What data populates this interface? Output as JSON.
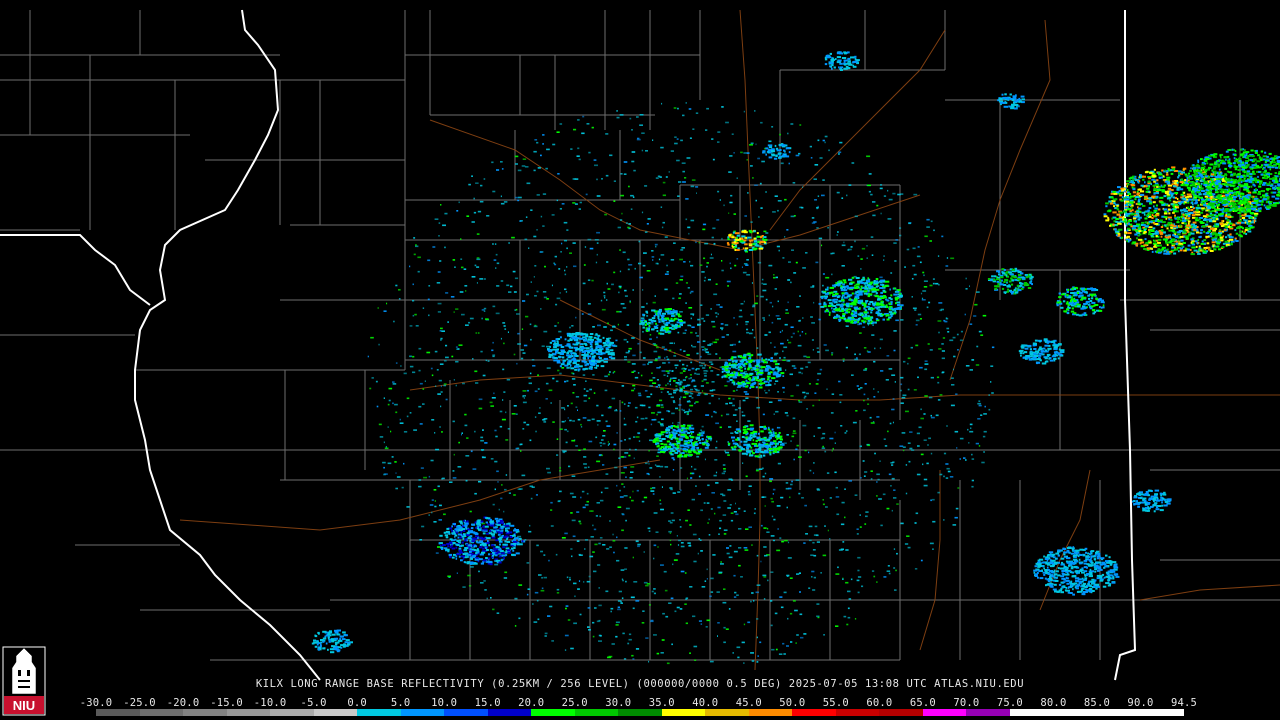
{
  "product_caption": "KILX LONG RANGE BASE REFLECTIVITY (0.25KM / 256 LEVEL) (000000/0000 0.5 DEG) 2025-07-05 13:08 UTC  ATLAS.NIU.EDU",
  "logo": {
    "text": "NIU",
    "colors": {
      "red": "#c8102e",
      "white": "#ffffff",
      "black": "#000000"
    }
  },
  "colorbar": {
    "ticks": [
      "-30.0",
      "-25.0",
      "-20.0",
      "-15.0",
      "-10.0",
      "-5.0",
      "0.0",
      "5.0",
      "10.0",
      "15.0",
      "20.0",
      "25.0",
      "30.0",
      "35.0",
      "40.0",
      "45.0",
      "50.0",
      "55.0",
      "60.0",
      "65.0",
      "70.0",
      "75.0",
      "80.0",
      "85.0",
      "90.0",
      "94.5"
    ],
    "segment_colors": [
      "#5a5a5a",
      "#6e6e6e",
      "#828282",
      "#979797",
      "#aaaaaa",
      "#c8c8c8",
      "#00c8e0",
      "#0096ff",
      "#0050ff",
      "#0000c8",
      "#00ff00",
      "#00c800",
      "#008c00",
      "#ffff00",
      "#e6bb00",
      "#ff8c00",
      "#ff0000",
      "#c80000",
      "#b40000",
      "#ff00ff",
      "#9600b4",
      "#ffffff",
      "#ffffff",
      "#ffffff",
      "#ffffff"
    ]
  },
  "colors": {
    "background": "#000000",
    "county_lines": "#8a8a8a",
    "state_lines": "#ffffff",
    "roads": "#8b4513"
  }
}
